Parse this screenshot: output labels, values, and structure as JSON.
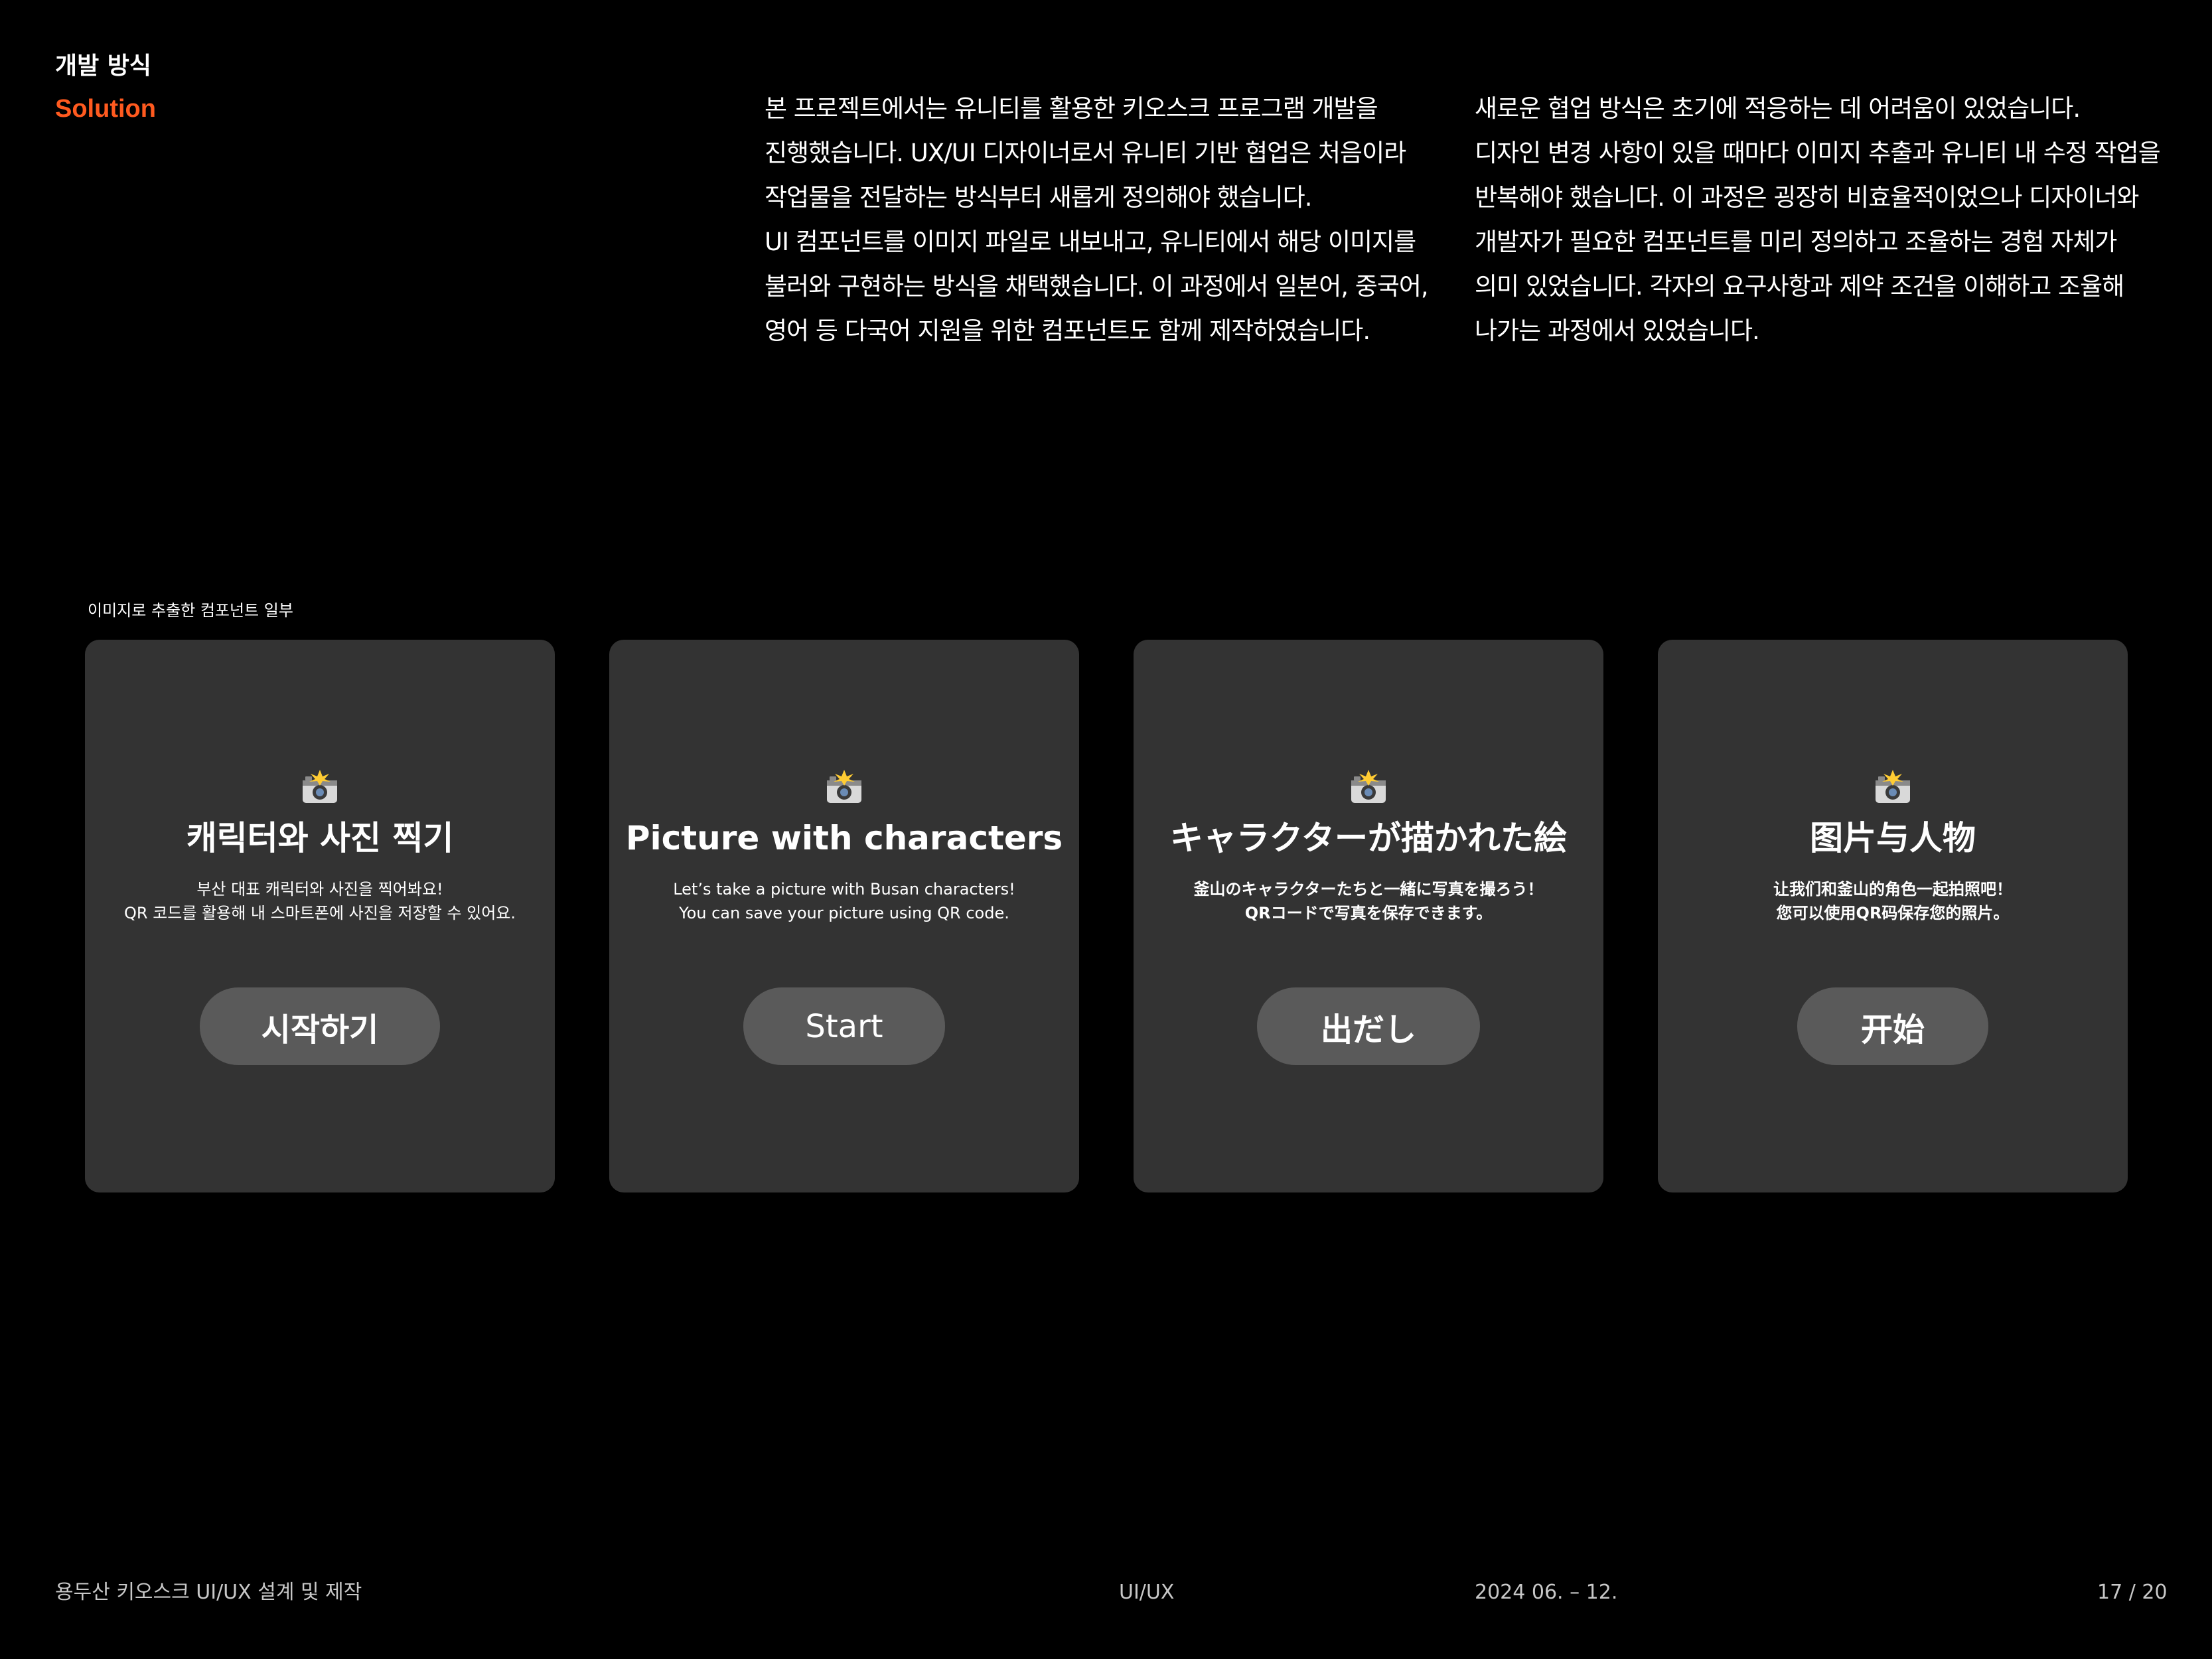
{
  "header": {
    "title": "개발 방식",
    "subtitle": "Solution"
  },
  "body_text": {
    "column1": [
      "본 프로젝트에서는 유니티를 활용한 키오스크 프로그램 개발을",
      "진행했습니다. UX/UI 디자이너로서 유니티 기반 협업은 처음이라",
      "작업물을 전달하는 방식부터 새롭게 정의해야 했습니다.",
      "UI 컴포넌트를 이미지 파일로 내보내고, 유니티에서 해당 이미지를",
      "불러와 구현하는 방식을 채택했습니다. 이 과정에서 일본어, 중국어,",
      "영어 등 다국어 지원을 위한 컴포넌트도 함께 제작하였습니다."
    ],
    "column2": [
      "새로운 협업 방식은 초기에 적응하는 데 어려움이 있었습니다.",
      "디자인 변경 사항이 있을 때마다 이미지 추출과 유니티 내 수정 작업을",
      "반복해야 했습니다. 이 과정은 굉장히 비효율적이었으나 디자이너와",
      "개발자가 필요한 컴포넌트를 미리 정의하고 조율하는 경험 자체가",
      "의미 있었습니다. 각자의 요구사항과 제약 조건을 이해하고 조율해",
      "나가는 과정에서 있었습니다."
    ]
  },
  "gallery": {
    "label": "이미지로 추출한 컴포넌트 일부",
    "cards": [
      {
        "icon": "camera-flash-icon",
        "title": "캐릭터와 사진 찍기",
        "desc_line1": "부산 대표 캐릭터와 사진을 찍어봐요!",
        "desc_line2": "QR 코드를 활용해 내 스마트폰에 사진을 저장할 수 있어요.",
        "button": "시작하기"
      },
      {
        "icon": "camera-flash-icon",
        "title": "Picture with characters",
        "desc_line1": "Let’s take a picture with Busan characters!",
        "desc_line2": "You can save your picture using QR code.",
        "button": "Start"
      },
      {
        "icon": "camera-flash-icon",
        "title": "キャラクターが描かれた絵",
        "desc_line1": "釜山のキャラクターたちと一緒に写真を撮ろう！",
        "desc_line2": "QRコードで写真を保存できます。",
        "button": "出だし"
      },
      {
        "icon": "camera-flash-icon",
        "title": "图片与人物",
        "desc_line1": "让我们和釜山的角色一起拍照吧！",
        "desc_line2": "您可以使用QR码保存您的照片。",
        "button": "开始"
      }
    ]
  },
  "footer": {
    "project": "용두산 키오스크 UI/UX 설계 및 제작",
    "category": "UI/UX",
    "period": "2024 06. – 12.",
    "page": "17 / 20"
  },
  "colors": {
    "background": "#000000",
    "accent": "#ff5a1f",
    "card": "#333333",
    "button": "#5a5a5a"
  }
}
